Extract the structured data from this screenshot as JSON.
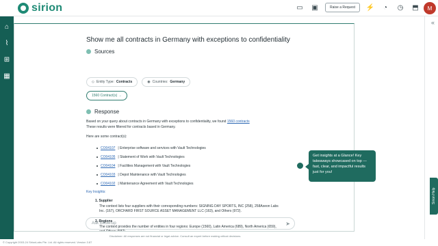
{
  "app": {
    "logo": "sirion"
  },
  "topbar": {
    "raise_request": "Raise a Request",
    "avatar_initial": "M"
  },
  "query": "Show me all contracts in Germany with exceptions to confidentiality",
  "sources": {
    "heading": "Sources",
    "entity_label": "Entity Type:",
    "entity_value": "Contracts",
    "country_label": "Countries:",
    "country_value": "Germany",
    "contracts_button": "1560 Contract(s)"
  },
  "response": {
    "heading": "Response",
    "intro_1": "Based on your query about contracts in Germany with exceptions to confidentiality, we found ",
    "intro_link": "1560 contracts",
    "intro_2": "These results were filtered for contracts based in Germany.",
    "some_contracts": "Here are some contract(s):",
    "contracts": [
      {
        "id": "CO04107",
        "desc": " | Enterprise software and services with Vault Technologies"
      },
      {
        "id": "CO04105",
        "desc": " | Statement of Work with Vault Technologies"
      },
      {
        "id": "CO04104",
        "desc": " | Facilities Management with Vault Technologies"
      },
      {
        "id": "CO04103",
        "desc": " | Depot Maintenance with Vault Technologies"
      },
      {
        "id": "CO04102",
        "desc": " | Maintenance Agreement with Vault Technologies"
      }
    ],
    "key_insights": "Key Insights:",
    "insight_1_title": "1. Supplier",
    "insight_1_text": "The context lists four suppliers with their corresponding numbers: SIGNING DAY SPORTS, INC (258), 258Axeon Labs Inc. (167), ORCHARD FIRST SOURCE ASSET MANAGEMENT LLC (163), and Others (972).",
    "insight_2_title": "2. Regions",
    "insight_2_text": "The context provides the number of entities in four regions: Europe (1560), Latin America (689), North America (659), and Others (587)."
  },
  "input": {
    "placeholder": "Ask follow-up"
  },
  "disclaimer": "Disclaimer: All responses are not financial or legal advice. Consult an expert before making critical decisions.",
  "copyright": "© Copyright 2003-24 SirionLabs Pte. Ltd. All rights reserved. Version 3.87",
  "tooltip": "Get insights at a Glance! Key takeaways showcased on top —fast, clear, and impactful results just for you!",
  "help_tab": "Sirion Help"
}
